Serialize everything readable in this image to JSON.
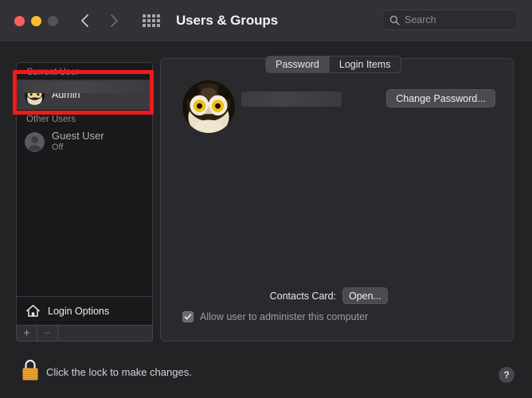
{
  "window": {
    "title": "Users & Groups",
    "traffic_lights": [
      "close-red",
      "minimize-yellow",
      "zoom-disabled-gray"
    ],
    "back_icon": "chevron-left-icon",
    "forward_icon": "chevron-right-icon",
    "grid_icon": "show-all-grid-icon"
  },
  "search": {
    "placeholder": "Search",
    "value": "",
    "icon": "search-icon"
  },
  "sidebar": {
    "groups": [
      {
        "header": "Current User",
        "users": [
          {
            "name": "Admin",
            "sub": "",
            "avatar": "owl-avatar",
            "selected": true,
            "redacted_name": true
          }
        ]
      },
      {
        "header": "Other Users",
        "users": [
          {
            "name": "Guest User",
            "sub": "Off",
            "avatar": "person-avatar",
            "selected": false,
            "redacted_name": false
          }
        ]
      }
    ],
    "login_options": {
      "label": "Login Options",
      "icon": "home-icon"
    },
    "add_button": "+",
    "remove_button": "−"
  },
  "highlight": {
    "color": "#ee1b1b",
    "target": "current-user-admin-row"
  },
  "panel": {
    "tabs": [
      {
        "label": "Password",
        "active": true
      },
      {
        "label": "Login Items",
        "active": false
      }
    ],
    "avatar": "owl-avatar",
    "account_name_redacted": true,
    "change_password_button": "Change Password...",
    "contacts_card_label": "Contacts Card:",
    "contacts_open_button": "Open...",
    "admin_checkbox": {
      "label": "Allow user to administer this computer",
      "checked": true,
      "enabled": false,
      "icon": "checkmark-icon"
    }
  },
  "footer": {
    "lock_icon": "padlock-closed-icon",
    "lock_color": "#f0a52e",
    "lock_text": "Click the lock to make changes.",
    "help_button": "?"
  }
}
